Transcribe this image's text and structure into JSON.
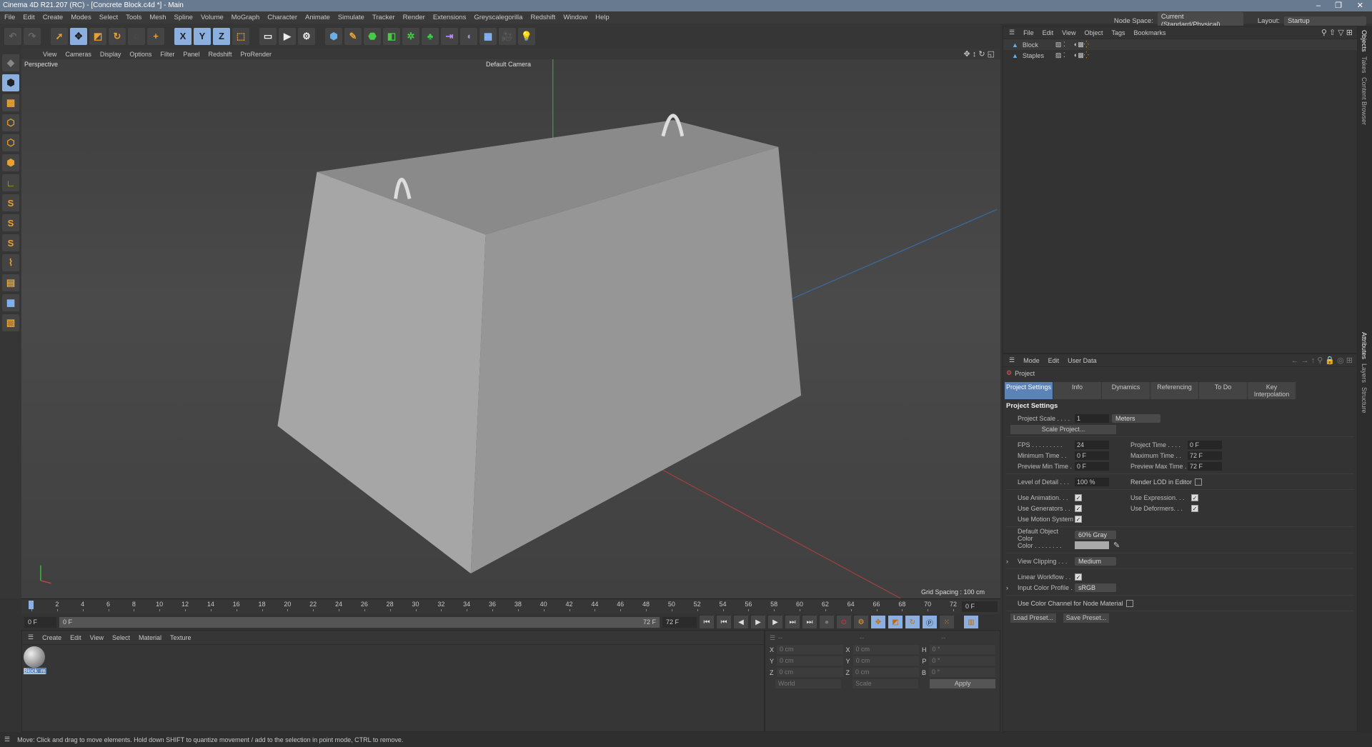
{
  "title": "Cinema 4D R21.207 (RC) - [Concrete Block.c4d *] - Main",
  "window_controls": [
    "–",
    "❐",
    "✕"
  ],
  "menu": [
    "File",
    "Edit",
    "Create",
    "Modes",
    "Select",
    "Tools",
    "Mesh",
    "Spline",
    "Volume",
    "MoGraph",
    "Character",
    "Animate",
    "Simulate",
    "Tracker",
    "Render",
    "Extensions",
    "Greyscalegorilla",
    "Redshift",
    "Window",
    "Help"
  ],
  "node_space": {
    "label": "Node Space:",
    "value": "Current (Standard/Physical)"
  },
  "layout": {
    "label": "Layout:",
    "value": "Startup"
  },
  "toolbar": {
    "x": "X",
    "y": "Y",
    "z": "Z"
  },
  "viewport": {
    "menu": [
      "View",
      "Cameras",
      "Display",
      "Options",
      "Filter",
      "Panel",
      "Redshift",
      "ProRender"
    ],
    "view_name": "Perspective",
    "camera": "Default Camera",
    "grid_spacing": "Grid Spacing : 100 cm"
  },
  "left_tools": {
    "s": "S"
  },
  "timeline": {
    "ruler": [
      "0",
      "2",
      "4",
      "6",
      "8",
      "10",
      "12",
      "14",
      "16",
      "18",
      "20",
      "22",
      "24",
      "26",
      "28",
      "30",
      "32",
      "34",
      "36",
      "38",
      "40",
      "42",
      "44",
      "46",
      "48",
      "50",
      "52",
      "54",
      "56",
      "58",
      "60",
      "62",
      "64",
      "66",
      "68",
      "70",
      "72"
    ],
    "current_frame": "0 F",
    "start": "0 F",
    "range_start": "0 F",
    "range_end": "72 F",
    "end": "72 F"
  },
  "material_manager": {
    "menu": [
      "Create",
      "Edit",
      "View",
      "Select",
      "Material",
      "Texture"
    ],
    "materials": [
      {
        "name": "Block_m"
      }
    ]
  },
  "coordinates": {
    "headers": [
      "--",
      "--",
      "--"
    ],
    "rows": [
      {
        "a": "X",
        "av": "0 cm",
        "b": "X",
        "bv": "0 cm",
        "c": "H",
        "cv": "0 °"
      },
      {
        "a": "Y",
        "av": "0 cm",
        "b": "Y",
        "bv": "0 cm",
        "c": "P",
        "cv": "0 °"
      },
      {
        "a": "Z",
        "av": "0 cm",
        "b": "Z",
        "bv": "0 cm",
        "c": "B",
        "cv": "0 °"
      }
    ],
    "mode": "World",
    "type": "Scale",
    "apply": "Apply"
  },
  "status": "Move: Click and drag to move elements. Hold down SHIFT to quantize movement / add to the selection in point mode, CTRL to remove.",
  "objects": {
    "menu": [
      "File",
      "Edit",
      "View",
      "Object",
      "Tags",
      "Bookmarks"
    ],
    "items": [
      {
        "name": "Block"
      },
      {
        "name": "Staples"
      }
    ]
  },
  "attributes": {
    "menu": [
      "Mode",
      "Edit",
      "User Data"
    ],
    "object": "Project",
    "tabs": [
      "Project Settings",
      "Info",
      "Dynamics",
      "Referencing",
      "To Do",
      "Key Interpolation"
    ],
    "section": "Project Settings",
    "project_scale": {
      "label": "Project Scale . . . .",
      "value": "1",
      "unit": "Meters"
    },
    "scale_project": "Scale Project...",
    "fps": {
      "label": "FPS . . . . . . . . .",
      "value": "24"
    },
    "project_time": {
      "label": "Project Time . . . .",
      "value": "0 F"
    },
    "min_time": {
      "label": "Minimum Time . .",
      "value": "0 F"
    },
    "max_time": {
      "label": "Maximum Time . .",
      "value": "72 F"
    },
    "prev_min": {
      "label": "Preview Min Time .",
      "value": "0 F"
    },
    "prev_max": {
      "label": "Preview Max Time .",
      "value": "72 F"
    },
    "lod": {
      "label": "Level of Detail . . .",
      "value": "100 %"
    },
    "render_lod": "Render LOD in Editor",
    "use_animation": "Use Animation. . .",
    "use_expression": "Use Expression. . .",
    "use_generators": "Use Generators . .",
    "use_deformers": "Use Deformers. . .",
    "use_motion": "Use Motion System",
    "default_color": {
      "label": "Default Object Color",
      "value": "60% Gray"
    },
    "color": "Color . . . . . . . .",
    "view_clipping": {
      "label": "View Clipping . . .",
      "value": "Medium"
    },
    "linear_workflow": "Linear Workflow . .",
    "input_profile": {
      "label": "Input Color Profile .",
      "value": "sRGB"
    },
    "node_material": "Use Color Channel for Node Material",
    "load_preset": "Load Preset...",
    "save_preset": "Save Preset..."
  },
  "side_tabs": [
    "Objects",
    "Takes",
    "Content Browser",
    "Attributes",
    "Layers",
    "Structure"
  ]
}
